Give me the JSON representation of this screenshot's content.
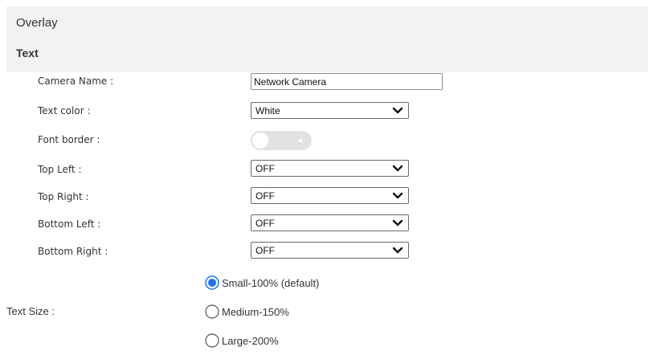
{
  "section": {
    "title": "Overlay",
    "subtitle": "Text"
  },
  "fields": {
    "camera_name": {
      "label": "Camera Name :",
      "value": "Network Camera"
    },
    "text_color": {
      "label": "Text color :",
      "value": "White"
    },
    "font_border": {
      "label": "Font border :",
      "enabled": false
    },
    "top_left": {
      "label": "Top Left :",
      "value": "OFF"
    },
    "top_right": {
      "label": "Top Right :",
      "value": "OFF"
    },
    "bottom_left": {
      "label": "Bottom Left :",
      "value": "OFF"
    },
    "bottom_right": {
      "label": "Bottom Right :",
      "value": "OFF"
    }
  },
  "text_size": {
    "label": "Text Size :",
    "options": [
      {
        "label": "Small-100% (default)",
        "selected": true
      },
      {
        "label": "Medium-150%",
        "selected": false
      },
      {
        "label": "Large-200%",
        "selected": false
      }
    ]
  },
  "colors": {
    "radio_selected": "#1a73e8",
    "toggle_off": "#e2e2e2",
    "header_band": "#f2f2f2"
  },
  "icons": {
    "select_arrow": "chevron-down-icon"
  }
}
